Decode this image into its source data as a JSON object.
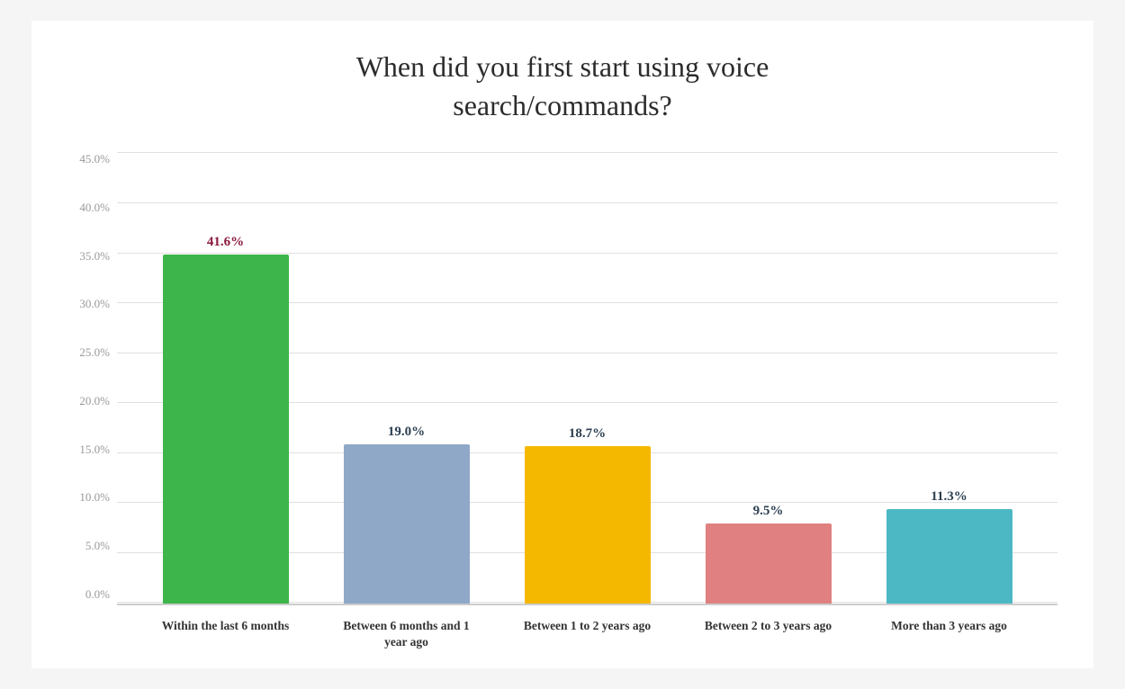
{
  "chart": {
    "title": "When did you first start using voice search/commands?",
    "y_axis": {
      "labels": [
        "45.0%",
        "40.0%",
        "35.0%",
        "30.0%",
        "25.0%",
        "20.0%",
        "15.0%",
        "10.0%",
        "5.0%",
        "0.0%"
      ]
    },
    "bars": [
      {
        "label": "Within the last 6 months",
        "value": "41.6%",
        "color": "#3db54a",
        "value_color": "#8b1a3b",
        "height_pct": 41.6
      },
      {
        "label": "Between 6 months and 1 year ago",
        "value": "19.0%",
        "color": "#8fa8c8",
        "value_color": "#2c3e50",
        "height_pct": 19.0
      },
      {
        "label": "Between 1 to 2 years ago",
        "value": "18.7%",
        "color": "#f5b800",
        "value_color": "#2c3e50",
        "height_pct": 18.7
      },
      {
        "label": "Between 2 to 3 years ago",
        "value": "9.5%",
        "color": "#e08080",
        "value_color": "#2c3e50",
        "height_pct": 9.5
      },
      {
        "label": "More than 3 years ago",
        "value": "11.3%",
        "color": "#4cb8c4",
        "value_color": "#2c3e50",
        "height_pct": 11.3
      }
    ]
  }
}
